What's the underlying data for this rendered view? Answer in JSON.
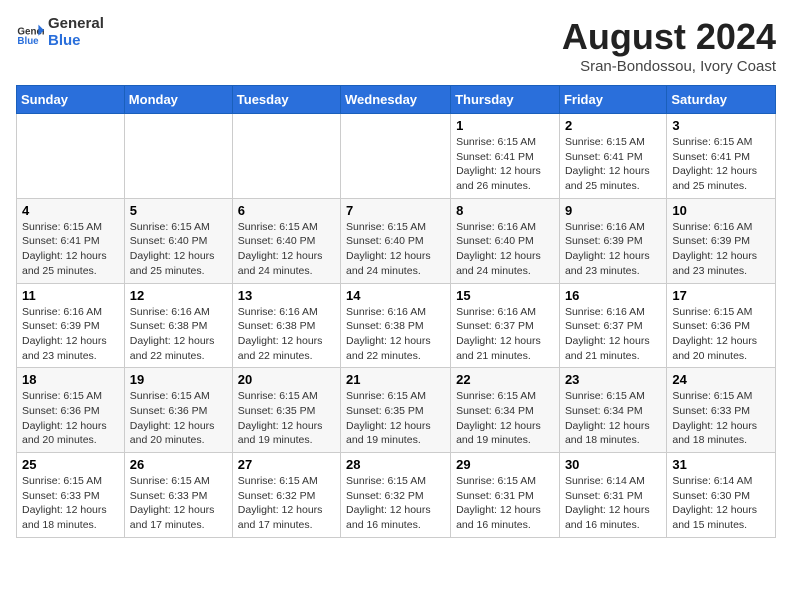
{
  "header": {
    "logo_general": "General",
    "logo_blue": "Blue",
    "month_year": "August 2024",
    "location": "Sran-Bondossou, Ivory Coast"
  },
  "days_of_week": [
    "Sunday",
    "Monday",
    "Tuesday",
    "Wednesday",
    "Thursday",
    "Friday",
    "Saturday"
  ],
  "weeks": [
    [
      {
        "day": "",
        "info": ""
      },
      {
        "day": "",
        "info": ""
      },
      {
        "day": "",
        "info": ""
      },
      {
        "day": "",
        "info": ""
      },
      {
        "day": "1",
        "info": "Sunrise: 6:15 AM\nSunset: 6:41 PM\nDaylight: 12 hours\nand 26 minutes."
      },
      {
        "day": "2",
        "info": "Sunrise: 6:15 AM\nSunset: 6:41 PM\nDaylight: 12 hours\nand 25 minutes."
      },
      {
        "day": "3",
        "info": "Sunrise: 6:15 AM\nSunset: 6:41 PM\nDaylight: 12 hours\nand 25 minutes."
      }
    ],
    [
      {
        "day": "4",
        "info": "Sunrise: 6:15 AM\nSunset: 6:41 PM\nDaylight: 12 hours\nand 25 minutes."
      },
      {
        "day": "5",
        "info": "Sunrise: 6:15 AM\nSunset: 6:40 PM\nDaylight: 12 hours\nand 25 minutes."
      },
      {
        "day": "6",
        "info": "Sunrise: 6:15 AM\nSunset: 6:40 PM\nDaylight: 12 hours\nand 24 minutes."
      },
      {
        "day": "7",
        "info": "Sunrise: 6:15 AM\nSunset: 6:40 PM\nDaylight: 12 hours\nand 24 minutes."
      },
      {
        "day": "8",
        "info": "Sunrise: 6:16 AM\nSunset: 6:40 PM\nDaylight: 12 hours\nand 24 minutes."
      },
      {
        "day": "9",
        "info": "Sunrise: 6:16 AM\nSunset: 6:39 PM\nDaylight: 12 hours\nand 23 minutes."
      },
      {
        "day": "10",
        "info": "Sunrise: 6:16 AM\nSunset: 6:39 PM\nDaylight: 12 hours\nand 23 minutes."
      }
    ],
    [
      {
        "day": "11",
        "info": "Sunrise: 6:16 AM\nSunset: 6:39 PM\nDaylight: 12 hours\nand 23 minutes."
      },
      {
        "day": "12",
        "info": "Sunrise: 6:16 AM\nSunset: 6:38 PM\nDaylight: 12 hours\nand 22 minutes."
      },
      {
        "day": "13",
        "info": "Sunrise: 6:16 AM\nSunset: 6:38 PM\nDaylight: 12 hours\nand 22 minutes."
      },
      {
        "day": "14",
        "info": "Sunrise: 6:16 AM\nSunset: 6:38 PM\nDaylight: 12 hours\nand 22 minutes."
      },
      {
        "day": "15",
        "info": "Sunrise: 6:16 AM\nSunset: 6:37 PM\nDaylight: 12 hours\nand 21 minutes."
      },
      {
        "day": "16",
        "info": "Sunrise: 6:16 AM\nSunset: 6:37 PM\nDaylight: 12 hours\nand 21 minutes."
      },
      {
        "day": "17",
        "info": "Sunrise: 6:15 AM\nSunset: 6:36 PM\nDaylight: 12 hours\nand 20 minutes."
      }
    ],
    [
      {
        "day": "18",
        "info": "Sunrise: 6:15 AM\nSunset: 6:36 PM\nDaylight: 12 hours\nand 20 minutes."
      },
      {
        "day": "19",
        "info": "Sunrise: 6:15 AM\nSunset: 6:36 PM\nDaylight: 12 hours\nand 20 minutes."
      },
      {
        "day": "20",
        "info": "Sunrise: 6:15 AM\nSunset: 6:35 PM\nDaylight: 12 hours\nand 19 minutes."
      },
      {
        "day": "21",
        "info": "Sunrise: 6:15 AM\nSunset: 6:35 PM\nDaylight: 12 hours\nand 19 minutes."
      },
      {
        "day": "22",
        "info": "Sunrise: 6:15 AM\nSunset: 6:34 PM\nDaylight: 12 hours\nand 19 minutes."
      },
      {
        "day": "23",
        "info": "Sunrise: 6:15 AM\nSunset: 6:34 PM\nDaylight: 12 hours\nand 18 minutes."
      },
      {
        "day": "24",
        "info": "Sunrise: 6:15 AM\nSunset: 6:33 PM\nDaylight: 12 hours\nand 18 minutes."
      }
    ],
    [
      {
        "day": "25",
        "info": "Sunrise: 6:15 AM\nSunset: 6:33 PM\nDaylight: 12 hours\nand 18 minutes."
      },
      {
        "day": "26",
        "info": "Sunrise: 6:15 AM\nSunset: 6:33 PM\nDaylight: 12 hours\nand 17 minutes."
      },
      {
        "day": "27",
        "info": "Sunrise: 6:15 AM\nSunset: 6:32 PM\nDaylight: 12 hours\nand 17 minutes."
      },
      {
        "day": "28",
        "info": "Sunrise: 6:15 AM\nSunset: 6:32 PM\nDaylight: 12 hours\nand 16 minutes."
      },
      {
        "day": "29",
        "info": "Sunrise: 6:15 AM\nSunset: 6:31 PM\nDaylight: 12 hours\nand 16 minutes."
      },
      {
        "day": "30",
        "info": "Sunrise: 6:14 AM\nSunset: 6:31 PM\nDaylight: 12 hours\nand 16 minutes."
      },
      {
        "day": "31",
        "info": "Sunrise: 6:14 AM\nSunset: 6:30 PM\nDaylight: 12 hours\nand 15 minutes."
      }
    ]
  ]
}
